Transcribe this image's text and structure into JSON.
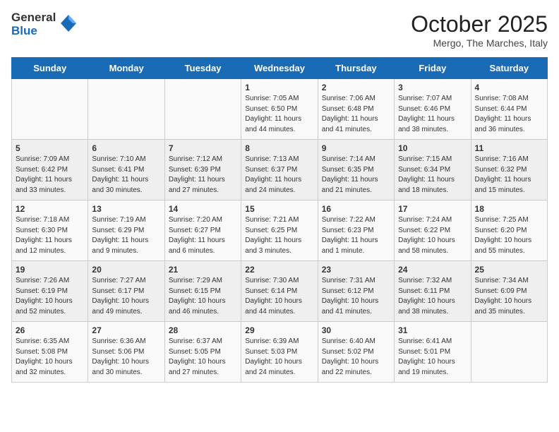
{
  "header": {
    "logo_general": "General",
    "logo_blue": "Blue",
    "month": "October 2025",
    "location": "Mergo, The Marches, Italy"
  },
  "days_of_week": [
    "Sunday",
    "Monday",
    "Tuesday",
    "Wednesday",
    "Thursday",
    "Friday",
    "Saturday"
  ],
  "weeks": [
    [
      {
        "num": "",
        "info": ""
      },
      {
        "num": "",
        "info": ""
      },
      {
        "num": "",
        "info": ""
      },
      {
        "num": "1",
        "info": "Sunrise: 7:05 AM\nSunset: 6:50 PM\nDaylight: 11 hours and 44 minutes."
      },
      {
        "num": "2",
        "info": "Sunrise: 7:06 AM\nSunset: 6:48 PM\nDaylight: 11 hours and 41 minutes."
      },
      {
        "num": "3",
        "info": "Sunrise: 7:07 AM\nSunset: 6:46 PM\nDaylight: 11 hours and 38 minutes."
      },
      {
        "num": "4",
        "info": "Sunrise: 7:08 AM\nSunset: 6:44 PM\nDaylight: 11 hours and 36 minutes."
      }
    ],
    [
      {
        "num": "5",
        "info": "Sunrise: 7:09 AM\nSunset: 6:42 PM\nDaylight: 11 hours and 33 minutes."
      },
      {
        "num": "6",
        "info": "Sunrise: 7:10 AM\nSunset: 6:41 PM\nDaylight: 11 hours and 30 minutes."
      },
      {
        "num": "7",
        "info": "Sunrise: 7:12 AM\nSunset: 6:39 PM\nDaylight: 11 hours and 27 minutes."
      },
      {
        "num": "8",
        "info": "Sunrise: 7:13 AM\nSunset: 6:37 PM\nDaylight: 11 hours and 24 minutes."
      },
      {
        "num": "9",
        "info": "Sunrise: 7:14 AM\nSunset: 6:35 PM\nDaylight: 11 hours and 21 minutes."
      },
      {
        "num": "10",
        "info": "Sunrise: 7:15 AM\nSunset: 6:34 PM\nDaylight: 11 hours and 18 minutes."
      },
      {
        "num": "11",
        "info": "Sunrise: 7:16 AM\nSunset: 6:32 PM\nDaylight: 11 hours and 15 minutes."
      }
    ],
    [
      {
        "num": "12",
        "info": "Sunrise: 7:18 AM\nSunset: 6:30 PM\nDaylight: 11 hours and 12 minutes."
      },
      {
        "num": "13",
        "info": "Sunrise: 7:19 AM\nSunset: 6:29 PM\nDaylight: 11 hours and 9 minutes."
      },
      {
        "num": "14",
        "info": "Sunrise: 7:20 AM\nSunset: 6:27 PM\nDaylight: 11 hours and 6 minutes."
      },
      {
        "num": "15",
        "info": "Sunrise: 7:21 AM\nSunset: 6:25 PM\nDaylight: 11 hours and 3 minutes."
      },
      {
        "num": "16",
        "info": "Sunrise: 7:22 AM\nSunset: 6:23 PM\nDaylight: 11 hours and 1 minute."
      },
      {
        "num": "17",
        "info": "Sunrise: 7:24 AM\nSunset: 6:22 PM\nDaylight: 10 hours and 58 minutes."
      },
      {
        "num": "18",
        "info": "Sunrise: 7:25 AM\nSunset: 6:20 PM\nDaylight: 10 hours and 55 minutes."
      }
    ],
    [
      {
        "num": "19",
        "info": "Sunrise: 7:26 AM\nSunset: 6:19 PM\nDaylight: 10 hours and 52 minutes."
      },
      {
        "num": "20",
        "info": "Sunrise: 7:27 AM\nSunset: 6:17 PM\nDaylight: 10 hours and 49 minutes."
      },
      {
        "num": "21",
        "info": "Sunrise: 7:29 AM\nSunset: 6:15 PM\nDaylight: 10 hours and 46 minutes."
      },
      {
        "num": "22",
        "info": "Sunrise: 7:30 AM\nSunset: 6:14 PM\nDaylight: 10 hours and 44 minutes."
      },
      {
        "num": "23",
        "info": "Sunrise: 7:31 AM\nSunset: 6:12 PM\nDaylight: 10 hours and 41 minutes."
      },
      {
        "num": "24",
        "info": "Sunrise: 7:32 AM\nSunset: 6:11 PM\nDaylight: 10 hours and 38 minutes."
      },
      {
        "num": "25",
        "info": "Sunrise: 7:34 AM\nSunset: 6:09 PM\nDaylight: 10 hours and 35 minutes."
      }
    ],
    [
      {
        "num": "26",
        "info": "Sunrise: 6:35 AM\nSunset: 5:08 PM\nDaylight: 10 hours and 32 minutes."
      },
      {
        "num": "27",
        "info": "Sunrise: 6:36 AM\nSunset: 5:06 PM\nDaylight: 10 hours and 30 minutes."
      },
      {
        "num": "28",
        "info": "Sunrise: 6:37 AM\nSunset: 5:05 PM\nDaylight: 10 hours and 27 minutes."
      },
      {
        "num": "29",
        "info": "Sunrise: 6:39 AM\nSunset: 5:03 PM\nDaylight: 10 hours and 24 minutes."
      },
      {
        "num": "30",
        "info": "Sunrise: 6:40 AM\nSunset: 5:02 PM\nDaylight: 10 hours and 22 minutes."
      },
      {
        "num": "31",
        "info": "Sunrise: 6:41 AM\nSunset: 5:01 PM\nDaylight: 10 hours and 19 minutes."
      },
      {
        "num": "",
        "info": ""
      }
    ]
  ]
}
